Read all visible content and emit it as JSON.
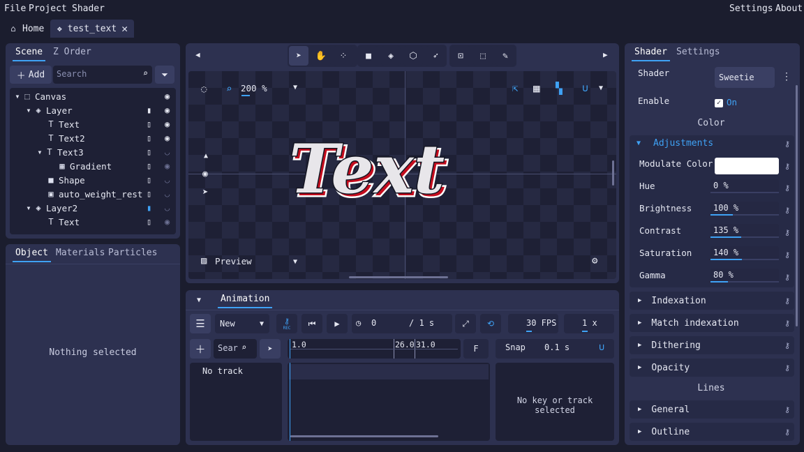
{
  "menu": {
    "file": "File",
    "project": "Project",
    "shader": "Shader",
    "settings": "Settings",
    "about": "About"
  },
  "tabs": {
    "home": "Home",
    "doc": "test_text"
  },
  "scene_panel": {
    "tab_scene": "Scene",
    "tab_zorder": "Z Order",
    "add_label": "Add",
    "search_placeholder": "Search",
    "tree": [
      {
        "label": "Canvas"
      },
      {
        "label": "Layer"
      },
      {
        "label": "Text"
      },
      {
        "label": "Text2"
      },
      {
        "label": "Text3"
      },
      {
        "label": "Gradient"
      },
      {
        "label": "Shape"
      },
      {
        "label": "auto_weight_rest"
      },
      {
        "label": "Layer2"
      },
      {
        "label": "Text"
      }
    ]
  },
  "object_panel": {
    "tab_object": "Object",
    "tab_materials": "Materials",
    "tab_particles": "Particles",
    "empty": "Nothing selected"
  },
  "viewport": {
    "zoom": "200 %",
    "preview": "Preview",
    "canvas_text": "Text"
  },
  "animation": {
    "tab": "Animation",
    "name": "New",
    "rec": "REC",
    "time_current": "0",
    "time_total": "/ 1 s",
    "fps": "30 FPS",
    "speed": "1 x",
    "search": "Sear",
    "tick_start": "1.0",
    "tick_mid1": "26.0",
    "tick_mid2": "31.0",
    "f_label": "F",
    "snap_label": "Snap",
    "snap_value": "0.1 s",
    "no_track": "No track",
    "no_key": "No key or track selected"
  },
  "inspector": {
    "tab_shader": "Shader",
    "tab_settings": "Settings",
    "shader_label": "Shader",
    "shader_value": "Sweetie",
    "enable_label": "Enable",
    "enable_value": "On",
    "color_header": "Color",
    "adjustments": "Adjustments",
    "modulate": "Modulate Color",
    "props": [
      {
        "label": "Hue",
        "value": "0 %",
        "fraction": 0.0
      },
      {
        "label": "Brightness",
        "value": "100 %",
        "fraction": 0.33
      },
      {
        "label": "Contrast",
        "value": "135 %",
        "fraction": 0.45
      },
      {
        "label": "Saturation",
        "value": "140 %",
        "fraction": 0.46
      },
      {
        "label": "Gamma",
        "value": "80 %",
        "fraction": 0.26
      }
    ],
    "sections": [
      "Indexation",
      "Match indexation",
      "Dithering",
      "Opacity"
    ],
    "lines_header": "Lines",
    "line_sections": [
      "General",
      "Outline"
    ]
  },
  "colors": {
    "accent": "#3fa2f5",
    "panel": "#2d3150",
    "bg": "#1b1d2e"
  }
}
